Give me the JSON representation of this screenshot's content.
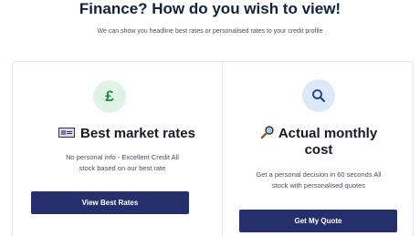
{
  "header": {
    "title": "Finance? How do you wish to view!",
    "subtitle": "We can show you headline best rates or personalised rates to your credit profile"
  },
  "cards": [
    {
      "icon": "pound-icon",
      "icon_glyph": "£",
      "title": "Best market rates",
      "description_line1": "No personal info - Excellent Credit All",
      "description_line2": "stock based on our best rate",
      "button_label": "View Best Rates"
    },
    {
      "icon": "search-icon",
      "title_line1": "Actual monthly",
      "title_line2": "cost",
      "description_line1": "Get a personal decision in 60 seconds All",
      "description_line2": "stock with personalised quotes",
      "button_label": "Get My Quote"
    }
  ],
  "colors": {
    "primary_button": "#252f6b",
    "green_badge": "#dff3e6",
    "blue_badge": "#dde8fb"
  }
}
